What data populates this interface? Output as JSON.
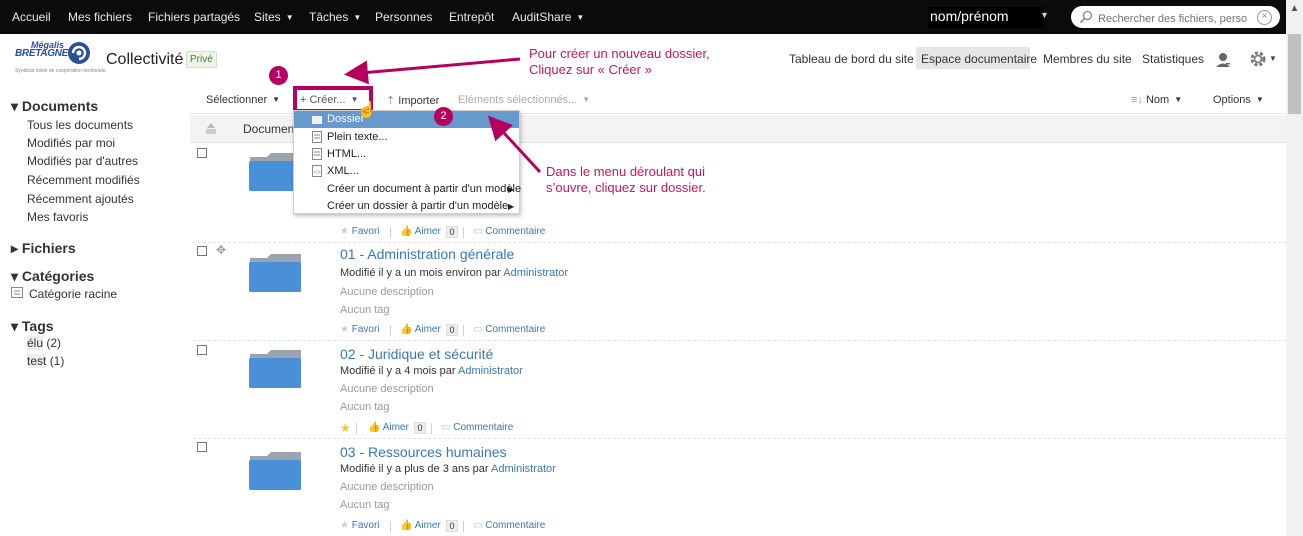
{
  "topnav": {
    "items": [
      "Accueil",
      "Mes fichiers",
      "Fichiers partagés",
      "Sites",
      "Tâches",
      "Personnes",
      "Entrepôt",
      "AuditShare"
    ],
    "user": "nom/prénom",
    "search_placeholder": "Rechercher des fichiers, perso"
  },
  "logo": {
    "line1": "Mégalis",
    "line2": "BRETAGNE",
    "tagline": "Syndicat mixte de coopération territoriale"
  },
  "site": {
    "title": "Collectivité",
    "badge": "Privé",
    "nav": [
      "Tableau de bord du site",
      "Espace documentaire",
      "Membres du site",
      "Statistiques"
    ]
  },
  "sidebar": {
    "documents_title": "Documents",
    "documents": [
      "Tous les documents",
      "Modifiés par moi",
      "Modifiés par d'autres",
      "Récemment modifiés",
      "Récemment ajoutés",
      "Mes favoris"
    ],
    "fichiers_title": "Fichiers",
    "categories_title": "Catégories",
    "categories": [
      "Catégorie racine"
    ],
    "tags_title": "Tags",
    "tags": [
      {
        "name": "élu",
        "count": "(2)"
      },
      {
        "name": "test",
        "count": "(1)"
      }
    ]
  },
  "toolbar": {
    "select": "Sélectionner",
    "create": "Créer...",
    "import": "Importer",
    "selected": "Eléments sélectionnés...",
    "sort": "Nom",
    "options": "Options"
  },
  "breadcrumb": "Documents",
  "dropdown": {
    "items": [
      "Dossier",
      "Plein texte...",
      "HTML...",
      "XML..."
    ],
    "templates": [
      "Créer un document à partir d'un modèle",
      "Créer un dossier à partir d'un modèle"
    ]
  },
  "rows": [
    {
      "title": "",
      "modified": "",
      "by": "",
      "desc": "",
      "tag": ""
    },
    {
      "title": "01 - Administration générale",
      "modified": "Modifié il y a un mois environ par ",
      "by": "Administrator",
      "desc": "Aucune description",
      "tag": "Aucun tag"
    },
    {
      "title": "02 - Juridique et sécurité",
      "modified": "Modifié il y a 4 mois par ",
      "by": "Administrator",
      "desc": "Aucune description",
      "tag": "Aucun tag"
    },
    {
      "title": "03 - Ressources humaines",
      "modified": "Modifié il y a plus de 3 ans par ",
      "by": "Administrator",
      "desc": "Aucune description",
      "tag": "Aucun tag"
    }
  ],
  "row_actions": {
    "favori": "Favori",
    "aimer": "Aimer",
    "count": "0",
    "comment": "Commentaire"
  },
  "annotations": {
    "step1": "1",
    "step2": "2",
    "callout1_line1": "Pour créer un nouveau dossier,",
    "callout1_line2": "Cliquez sur « Créer »",
    "callout2_line1": "Dans le menu déroulant qui",
    "callout2_line2": "s’ouvre, cliquez sur dossier."
  },
  "colors": {
    "accent": "#b5005e",
    "link": "#3a77b7",
    "folder": "#4a90d9",
    "highlight": "#6699cc"
  }
}
